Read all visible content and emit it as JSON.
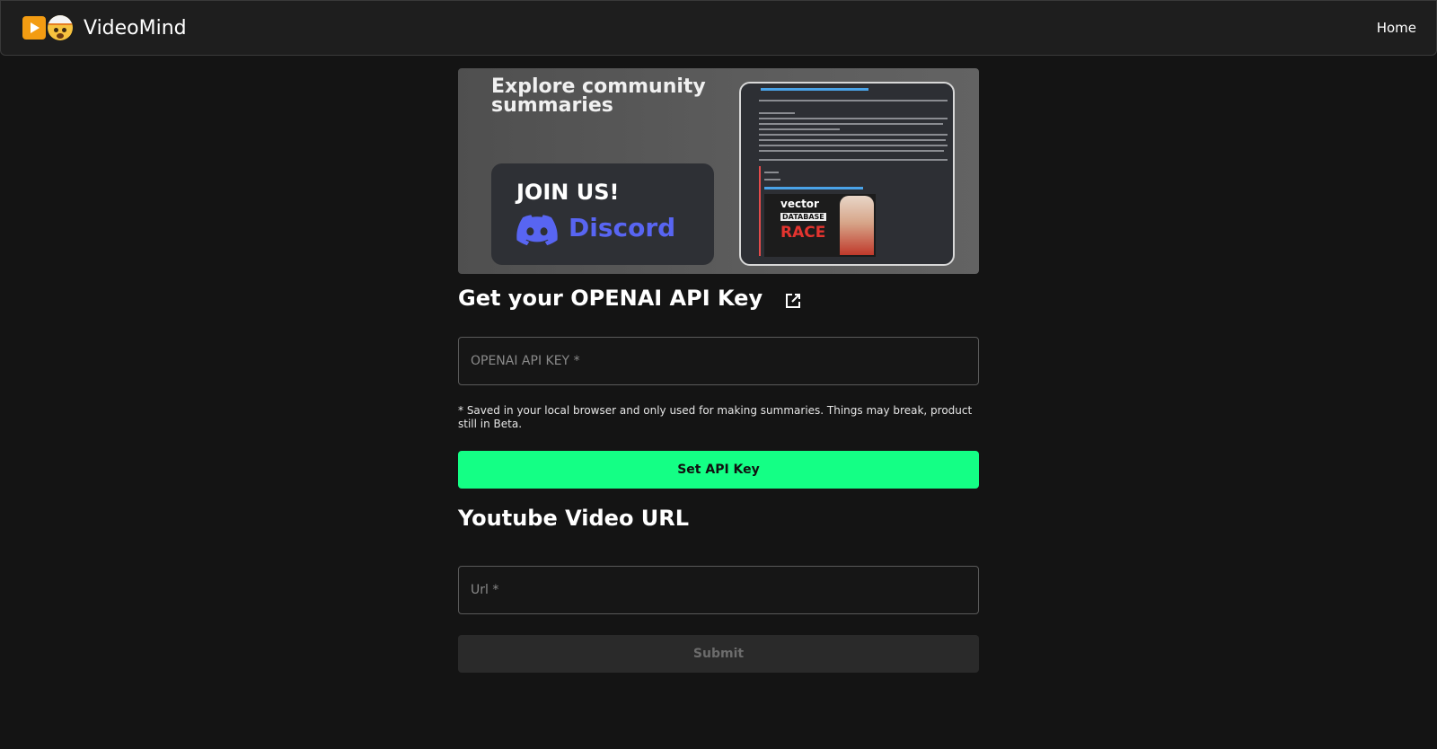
{
  "navbar": {
    "brand_name": "VideoMind",
    "brand_icons": [
      "play-button-icon",
      "exploding-head-icon"
    ],
    "home_label": "Home"
  },
  "banner": {
    "title": "Explore community summaries",
    "join_text": "JOIN US!",
    "discord_text": "Discord",
    "preview_thumb": {
      "line1": "vector",
      "line2": "DATABASE",
      "line3": "RACE"
    }
  },
  "api_section": {
    "heading": "Get your OPENAI API Key",
    "heading_icon": "external-link-icon",
    "input_placeholder": "OPENAI API KEY *",
    "input_value": "",
    "note": "* Saved in your local browser and only used for making summaries. Things may break, product still in Beta.",
    "button_label": "Set API Key"
  },
  "url_section": {
    "heading": "Youtube Video URL",
    "input_placeholder": "Url *",
    "input_value": "",
    "button_label": "Submit"
  },
  "colors": {
    "background": "#141414",
    "navbar": "#1e1e1e",
    "accent_green": "#14ff85",
    "discord_blurple": "#5865f2",
    "disabled_button": "#2a2a2a"
  }
}
